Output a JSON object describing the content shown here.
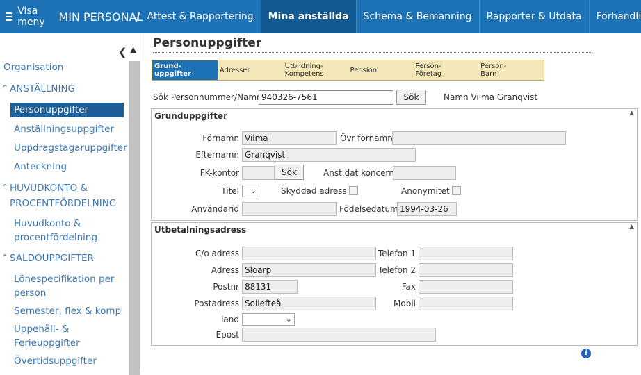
{
  "topbar": {
    "menu_label": "Visa meny",
    "brand": "MIN PERSONAL",
    "separator": "/",
    "tabs": [
      "Attest & Rapportering",
      "Mina anställda",
      "Schema & Bemanning",
      "Rapporter & Utdata",
      "Förhandling"
    ],
    "active_tab": "Mina anställda"
  },
  "sidebar": {
    "organisation": "Organisation",
    "anstallning": "ANSTÄLLNING",
    "personuppgifter": "Personuppgifter",
    "anstallningsuppgifter": "Anställningsuppgifter",
    "uppdragstagaruppgifter": "Uppdragstagaruppgifter",
    "anteckning": "Anteckning",
    "huvudkonto_group_1": "HUVUDKONTO &",
    "huvudkonto_group_2": "PROCENTFÖRDELNING",
    "huvudkonto_item_1": "Huvudkonto &",
    "huvudkonto_item_2": "procentfördelning",
    "saldo_group": "SALDOUPPGIFTER",
    "lonespec_1": "Lönespecifikation per",
    "lonespec_2": "person",
    "semester": "Semester, flex & komp",
    "uppehall_1": "Uppehåll- &",
    "uppehall_2": "Ferieuppgifter",
    "overtid": "Övertidsuppgifter"
  },
  "main": {
    "title": "Personuppgifter",
    "tabs": [
      {
        "l1": "Grund-",
        "l2": "uppgifter"
      },
      {
        "l1": "Adresser",
        "l2": ""
      },
      {
        "l1": "Utbildning-",
        "l2": "Kompetens"
      },
      {
        "l1": "Pension",
        "l2": ""
      },
      {
        "l1": "Person-",
        "l2": "Företag"
      },
      {
        "l1": "Person-",
        "l2": "Barn"
      }
    ],
    "search_label": "Sök Personnummer/Namn",
    "search_value": "940326-7561",
    "search_button": "Sök",
    "name_display": "Namn Vilma Granqvist",
    "grund": {
      "heading": "Grunduppgifter",
      "fornamn_label": "Förnamn",
      "fornamn": "Vilma",
      "ovr_fornamn_label": "Övr förnamn",
      "ovr_fornamn": "",
      "efternamn_label": "Efternamn",
      "efternamn": "Granqvist",
      "fk_label": "FK-kontor",
      "fk_value": "",
      "fk_button": "Sök",
      "anst_label": "Anst.dat koncern",
      "anst_value": "",
      "titel_label": "Titel",
      "skyddad_label": "Skyddad adress",
      "anonymitet_label": "Anonymitet",
      "anvandarid_label": "Användarid",
      "anvandarid": "",
      "fodelsedatum_label": "Födelsedatum",
      "fodelsedatum": "1994-03-26"
    },
    "utbet": {
      "heading": "Utbetalningsadress",
      "co_label": "C/o adress",
      "co": "",
      "tel1_label": "Telefon 1",
      "tel1": "",
      "adress_label": "Adress",
      "adress": "Sloarp",
      "tel2_label": "Telefon 2",
      "tel2": "",
      "postnr_label": "Postnr",
      "postnr": "88131",
      "fax_label": "Fax",
      "fax": "",
      "postadress_label": "Postadress",
      "postadress": "Sollefteå",
      "mobil_label": "Mobil",
      "mobil": "",
      "land_label": "land",
      "epost_label": "Epost",
      "epost": ""
    },
    "info_icon": "i"
  }
}
